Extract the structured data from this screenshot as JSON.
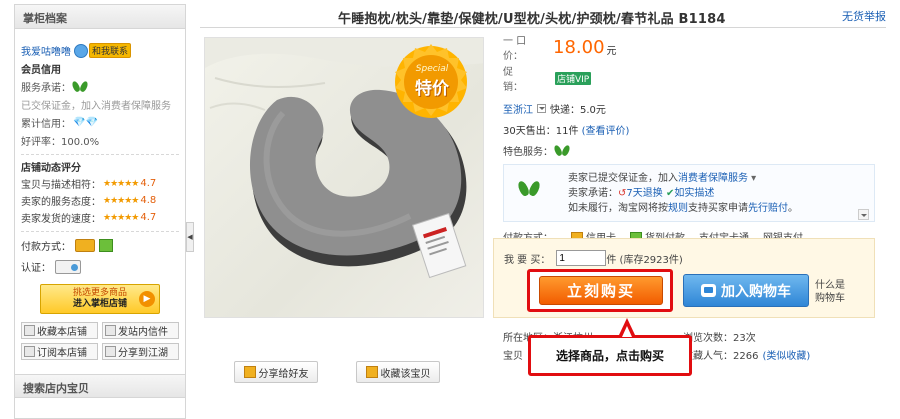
{
  "sidebar": {
    "header": "掌柜档案",
    "seller_name": "我爱咕噜噜",
    "contact_label": "和我联系",
    "credit_title": "会员信用",
    "service_promise": "服务承诺：",
    "deposit_note": "已交保证金，加入消费者保障服务",
    "credit_score": "累计信用：",
    "positive_rate": "好评率：100.0%",
    "rating_title": "店铺动态评分",
    "ratings": [
      {
        "label": "宝贝与描述相符：",
        "stars": "★★★★★",
        "value": "4.7"
      },
      {
        "label": "卖家的服务态度：",
        "stars": "★★★★★",
        "value": "4.8"
      },
      {
        "label": "卖家发货的速度：",
        "stars": "★★★★★",
        "value": "4.7"
      }
    ],
    "payment_label": "付款方式：",
    "auth_label": "认证：",
    "shop_button": {
      "line1": "挑选更多商品",
      "line2": "进入掌柜店铺"
    },
    "small_buttons": [
      "收藏本店铺",
      "发站内信件",
      "订阅本店铺",
      "分享到江湖"
    ],
    "bottom_header": "搜索店内宝贝"
  },
  "header": {
    "title": "午睡抱枕/枕头/靠垫/保健枕/U型枕/头枕/护颈枕/春节礼品 B1184",
    "report_link": "无货举报"
  },
  "image": {
    "special_badge_top": "Special",
    "special_badge_text": "特价"
  },
  "image_buttons": [
    "分享给好友",
    "收藏该宝贝"
  ],
  "details": {
    "price_label": "一 口 价：",
    "price": "18.00",
    "price_unit": "元",
    "promo_label": "促　　销：",
    "promo_badge": "店铺VIP",
    "ship_to": "至浙江",
    "shipping": "快递：5.0元",
    "sold_prefix": "30天售出：11件",
    "sold_link": "(查看评价)",
    "special_service": "特色服务：",
    "guarantee": {
      "line1_prefix": "卖家已提交保证金，加入",
      "line1_link": "消费者保障服务",
      "line2_prefix": "卖家承诺：",
      "return_link": "7天退换",
      "desc_link": "如实描述",
      "line3_prefix": "如未履行，淘宝网将按",
      "rule_link": "规则",
      "line3_mid": "支持买家申请",
      "compensation_link": "先行赔付",
      "line3_end": "。"
    },
    "payment_label": "付款方式：",
    "payment_methods": [
      "信用卡",
      "货到付款",
      "支付宝卡通",
      "网银支付"
    ]
  },
  "buy": {
    "qty_label": "我 要 买：",
    "qty_value": "1",
    "stock_text": "件 (库存2923件)",
    "buy_now": "立刻购买",
    "add_cart": "加入购物车",
    "what_cart_1": "什么是",
    "what_cart_2": "购物车"
  },
  "info": {
    "location": "所在地区：浙江杭州",
    "views": "浏览次数：23次",
    "item_prefix": "宝贝",
    "favorites": "收藏人气：2266",
    "favorites_link": "(类似收藏)"
  },
  "callout": "选择商品，点击购买",
  "colors": {
    "price": "#ff6600",
    "buy_now": "#f25c00",
    "add_cart": "#2f86d6",
    "highlight": "#e10d10",
    "link": "#1a5fb4"
  }
}
